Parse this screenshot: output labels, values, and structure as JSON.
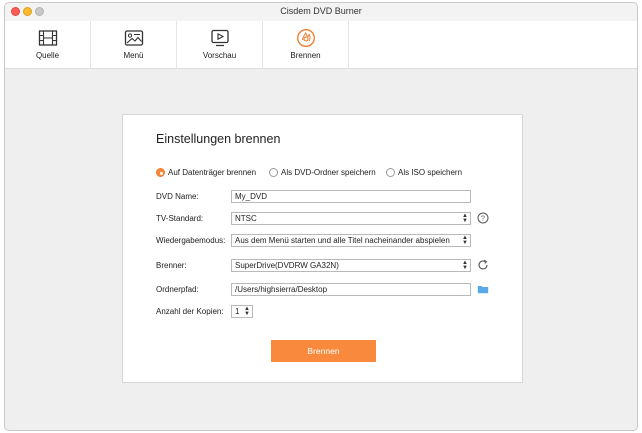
{
  "window": {
    "title": "Cisdem DVD Burner"
  },
  "toolbar": {
    "tabs": [
      {
        "label": "Quelle",
        "icon": "film-icon"
      },
      {
        "label": "Menü",
        "icon": "menu-image-icon"
      },
      {
        "label": "Vorschau",
        "icon": "preview-play-icon"
      },
      {
        "label": "Brennen",
        "icon": "burn-disc-icon",
        "active": true
      }
    ]
  },
  "panel": {
    "title": "Einstellungen brennen",
    "output_options": [
      {
        "label": "Auf Datenträger brennen",
        "selected": true
      },
      {
        "label": "Als DVD-Ordner speichern",
        "selected": false
      },
      {
        "label": "Als ISO speichern",
        "selected": false
      }
    ],
    "dvd_name": {
      "label": "DVD Name:",
      "value": "My_DVD"
    },
    "tv_standard": {
      "label": "TV-Standard:",
      "value": "NTSC"
    },
    "playback_mode": {
      "label": "Wiedergabemodus:",
      "value": "Aus dem Menü starten und alle Titel nacheinander abspielen"
    },
    "burner": {
      "label": "Brenner:",
      "value": "SuperDrive(DVDRW  GA32N)"
    },
    "folder_path": {
      "label": "Ordnerpfad:",
      "value": "/Users/highsierra/Desktop"
    },
    "copies": {
      "label": "Anzahl der Kopien:",
      "value": "1"
    },
    "burn_button": "Brennen"
  },
  "colors": {
    "accent": "#f98a3d",
    "radio_selected": "#f8883a"
  }
}
